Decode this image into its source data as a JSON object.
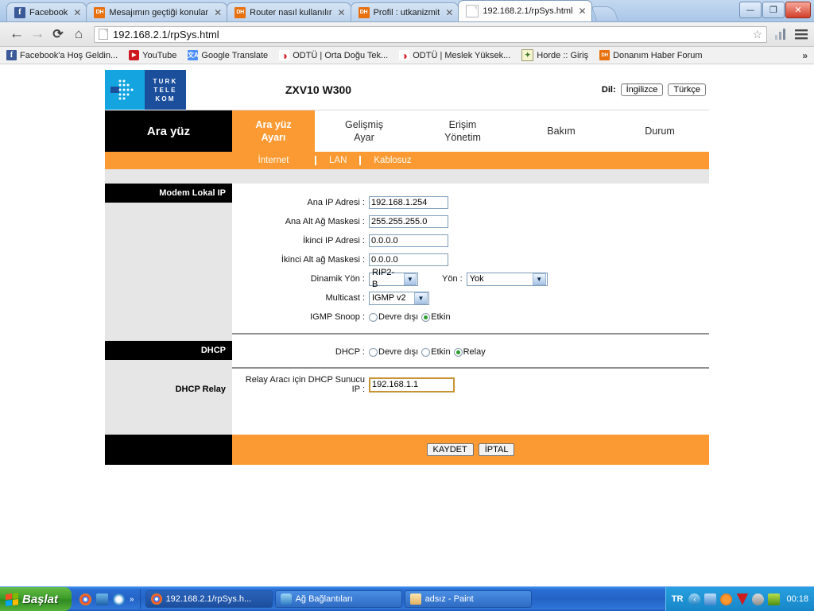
{
  "browser": {
    "tabs": [
      {
        "title": "Facebook",
        "icon": "facebook-favicon",
        "active": false
      },
      {
        "title": "Mesajımın geçtiği konular",
        "icon": "donanimhaber-favicon",
        "active": false
      },
      {
        "title": "Router nasıl kullanılır",
        "icon": "donanimhaber-favicon",
        "active": false
      },
      {
        "title": "Profil : utkanizmit",
        "icon": "donanimhaber-favicon",
        "active": false
      },
      {
        "title": "192.168.2.1/rpSys.html",
        "icon": "page-favicon",
        "active": true
      }
    ],
    "tab_close_glyph": "✕",
    "window_controls": {
      "minimize": "—",
      "maximize": "❐",
      "close": "✕"
    },
    "nav": {
      "back": "←",
      "forward": "→",
      "reload": "⟳",
      "home": "⌂",
      "url": "192.168.2.1/rpSys.html",
      "star": "☆",
      "menu": "☰",
      "extension": "signal-icon"
    },
    "bookmarks": [
      {
        "label": "Facebook'a Hoş Geldin...",
        "icon": "facebook-favicon"
      },
      {
        "label": "YouTube",
        "icon": "youtube-favicon"
      },
      {
        "label": "Google Translate",
        "icon": "google-translate-favicon"
      },
      {
        "label": "ODTÜ | Orta Doğu Tek...",
        "icon": "opera-favicon"
      },
      {
        "label": "ODTÜ | Meslek Yüksek...",
        "icon": "opera-favicon"
      },
      {
        "label": "Horde :: Giriş",
        "icon": "horde-favicon"
      },
      {
        "label": "Donanım Haber Forum",
        "icon": "donanimhaber-favicon"
      }
    ],
    "bookmarks_overflow": "»"
  },
  "router": {
    "brand": {
      "logo_lines": [
        "TURK",
        "TELE",
        "KOM"
      ],
      "model": "ZXV10 W300",
      "lang_label": "Dil:",
      "lang_buttons": [
        "İngilizce",
        "Türkçe"
      ]
    },
    "nav": {
      "section_title": "Ara yüz",
      "items": [
        {
          "label_line1": "Ara yüz",
          "label_line2": "Ayarı",
          "active": true
        },
        {
          "label_line1": "Gelişmiş",
          "label_line2": "Ayar",
          "active": false
        },
        {
          "label_line1": "Erişim",
          "label_line2": "Yönetim",
          "active": false
        },
        {
          "label_line1": "Bakım",
          "label_line2": "",
          "active": false
        },
        {
          "label_line1": "Durum",
          "label_line2": "",
          "active": false
        }
      ],
      "subitems": [
        {
          "label": "İnternet",
          "active": true
        },
        {
          "label": "LAN",
          "active": false
        },
        {
          "label": "Kablosuz",
          "active": false
        }
      ]
    },
    "sections": {
      "modem_local_ip": "Modem Lokal IP",
      "dhcp": "DHCP",
      "dhcp_relay": "DHCP Relay"
    },
    "fields": [
      {
        "label": "Ana IP Adresi :",
        "value": "192.168.1.254",
        "type": "text"
      },
      {
        "label": "Ana Alt Ağ Maskesi :",
        "value": "255.255.255.0",
        "type": "text"
      },
      {
        "label": "İkinci IP Adresi :",
        "value": "0.0.0.0",
        "type": "text"
      },
      {
        "label": "İkinci Alt ağ Maskesi :",
        "value": "0.0.0.0",
        "type": "text"
      }
    ],
    "dinamik_yon": {
      "label": "Dinamik Yön :",
      "value": "RIP2-B"
    },
    "yon": {
      "label": "Yön :",
      "value": "Yok"
    },
    "multicast": {
      "label": "Multicast :",
      "value": "IGMP v2"
    },
    "igmp_snoop": {
      "label": "IGMP Snoop :",
      "options": [
        {
          "label": "Devre dışı",
          "selected": false
        },
        {
          "label": "Etkin",
          "selected": true
        }
      ]
    },
    "dhcp_mode": {
      "label": "DHCP :",
      "options": [
        {
          "label": "Devre dışı",
          "selected": false
        },
        {
          "label": "Etkin",
          "selected": false
        },
        {
          "label": "Relay",
          "selected": true
        }
      ]
    },
    "relay_server": {
      "label_line1": "Relay Aracı için DHCP Sunucu",
      "label_line2": "IP",
      "label_colon": ":",
      "value": "192.168.1.1"
    },
    "actions": {
      "save": "KAYDET",
      "cancel": "İPTAL"
    },
    "colors": {
      "accent_orange": "#fb9a33",
      "logo_blue": "#14a5e0",
      "logo_navy": "#1b4f9c"
    }
  },
  "taskbar": {
    "start": "Başlat",
    "quicklaunch_overflow": "»",
    "tasks": [
      {
        "label": "192.168.2.1/rpSys.h...",
        "icon": "chrome-icon",
        "active": true
      },
      {
        "label": "Ağ Bağlantıları",
        "icon": "network-icon",
        "active": false
      },
      {
        "label": "adsız - Paint",
        "icon": "paint-icon",
        "active": false
      }
    ],
    "tray": {
      "language": "TR",
      "clock": "00:18"
    }
  }
}
